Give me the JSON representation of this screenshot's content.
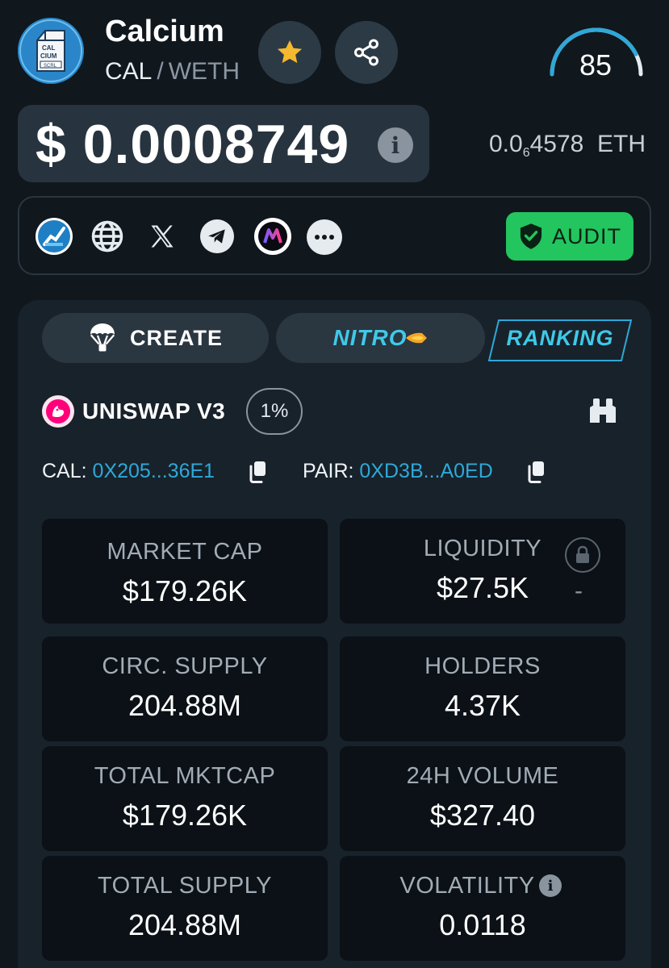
{
  "token": {
    "name": "Calcium",
    "symbol": "CAL",
    "quote": "WETH",
    "logo_text": [
      "CAL",
      "CIUM",
      "SCRL"
    ],
    "score": "85",
    "score_fraction": 0.85
  },
  "price": {
    "usd": "$ 0.0008749",
    "eth_prefix": "0.0",
    "eth_sub": "6",
    "eth_digits": "4578",
    "eth_unit": "ETH"
  },
  "socials": {
    "items": [
      "chart-icon",
      "globe-icon",
      "x-icon",
      "telegram-icon",
      "dextools-icon",
      "more-icon"
    ],
    "audit_label": "AUDIT"
  },
  "tabs": {
    "create": "CREATE",
    "nitro": "NITRO",
    "ranking": "RANKING"
  },
  "dex": {
    "name": "UNISWAP V3",
    "fee": "1%"
  },
  "addresses": {
    "token_label": "CAL:",
    "token_value": "0X205...36E1",
    "pair_label": "PAIR:",
    "pair_value": "0XD3B...A0ED"
  },
  "stats": {
    "market_cap": {
      "label": "MARKET CAP",
      "value": "$179.26K"
    },
    "liquidity": {
      "label": "LIQUIDITY",
      "value": "$27.5K",
      "lock_value": "-"
    },
    "circ_supply": {
      "label": "CIRC. SUPPLY",
      "value": "204.88M"
    },
    "holders": {
      "label": "HOLDERS",
      "value": "4.37K"
    },
    "total_mktcap": {
      "label": "TOTAL MKTCAP",
      "value": "$179.26K"
    },
    "volume_24h": {
      "label": "24H VOLUME",
      "value": "$327.40"
    },
    "total_supply": {
      "label": "TOTAL SUPPLY",
      "value": "204.88M"
    },
    "volatility": {
      "label": "VOLATILITY",
      "value": "0.0118"
    }
  },
  "colors": {
    "background": "#10171d",
    "accent_cyan": "#2ea8d8",
    "audit_green": "#22c55e",
    "star_gold": "#f5b82e"
  }
}
